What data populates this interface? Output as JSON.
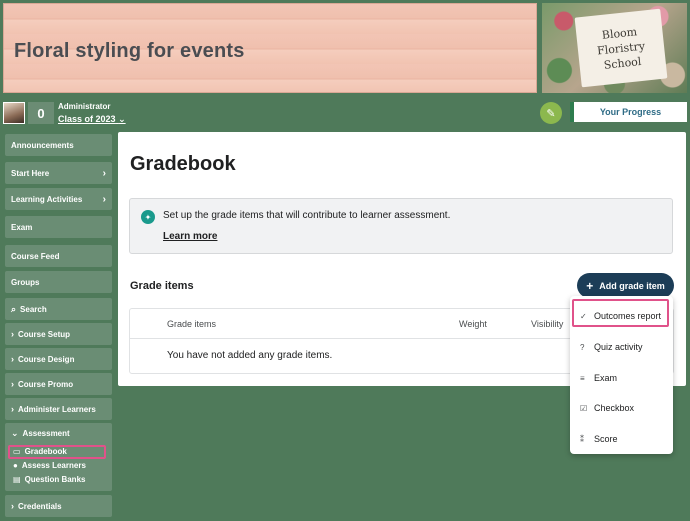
{
  "banner": {
    "title": "Floral styling for events",
    "school_lines": [
      "Bloom",
      "Floristry",
      "School"
    ]
  },
  "header": {
    "count": "0",
    "role": "Administrator",
    "class_link": "Class of 2023",
    "progress_label": "Your Progress"
  },
  "sidebar": {
    "items": [
      {
        "label": "Announcements"
      },
      {
        "label": "Start Here"
      },
      {
        "label": "Learning Activities"
      },
      {
        "label": "Exam"
      },
      {
        "label": "Course Feed"
      },
      {
        "label": "Groups"
      },
      {
        "label": "Search"
      },
      {
        "label": "Course Setup"
      },
      {
        "label": "Course Design"
      },
      {
        "label": "Course Promo"
      },
      {
        "label": "Administer Learners"
      },
      {
        "label": "Assessment"
      },
      {
        "label": "Credentials"
      }
    ],
    "assessment_sub": [
      {
        "label": "Gradebook"
      },
      {
        "label": "Assess Learners"
      },
      {
        "label": "Question Banks"
      }
    ]
  },
  "main": {
    "title": "Gradebook",
    "info_text": "Set up the grade items that will contribute to learner assessment.",
    "learn_more": "Learn more",
    "section_title": "Grade items",
    "add_button": "Add grade item",
    "table": {
      "headers": [
        "Grade items",
        "Weight",
        "Visibility"
      ],
      "empty_message": "You have not added any grade items."
    }
  },
  "dropdown": {
    "items": [
      {
        "label": "Outcomes report",
        "icon": "outcomes-icon"
      },
      {
        "label": "Quiz activity",
        "icon": "quiz-icon"
      },
      {
        "label": "Exam",
        "icon": "exam-icon"
      },
      {
        "label": "Checkbox",
        "icon": "checkbox-icon"
      },
      {
        "label": "Score",
        "icon": "score-icon"
      }
    ]
  },
  "colors": {
    "page_bg": "#4f7a5a",
    "sidebar_item": "#6a8d74",
    "accent_button": "#1c3d57",
    "highlight": "#e0528a",
    "info_icon": "#1a9a8c"
  }
}
